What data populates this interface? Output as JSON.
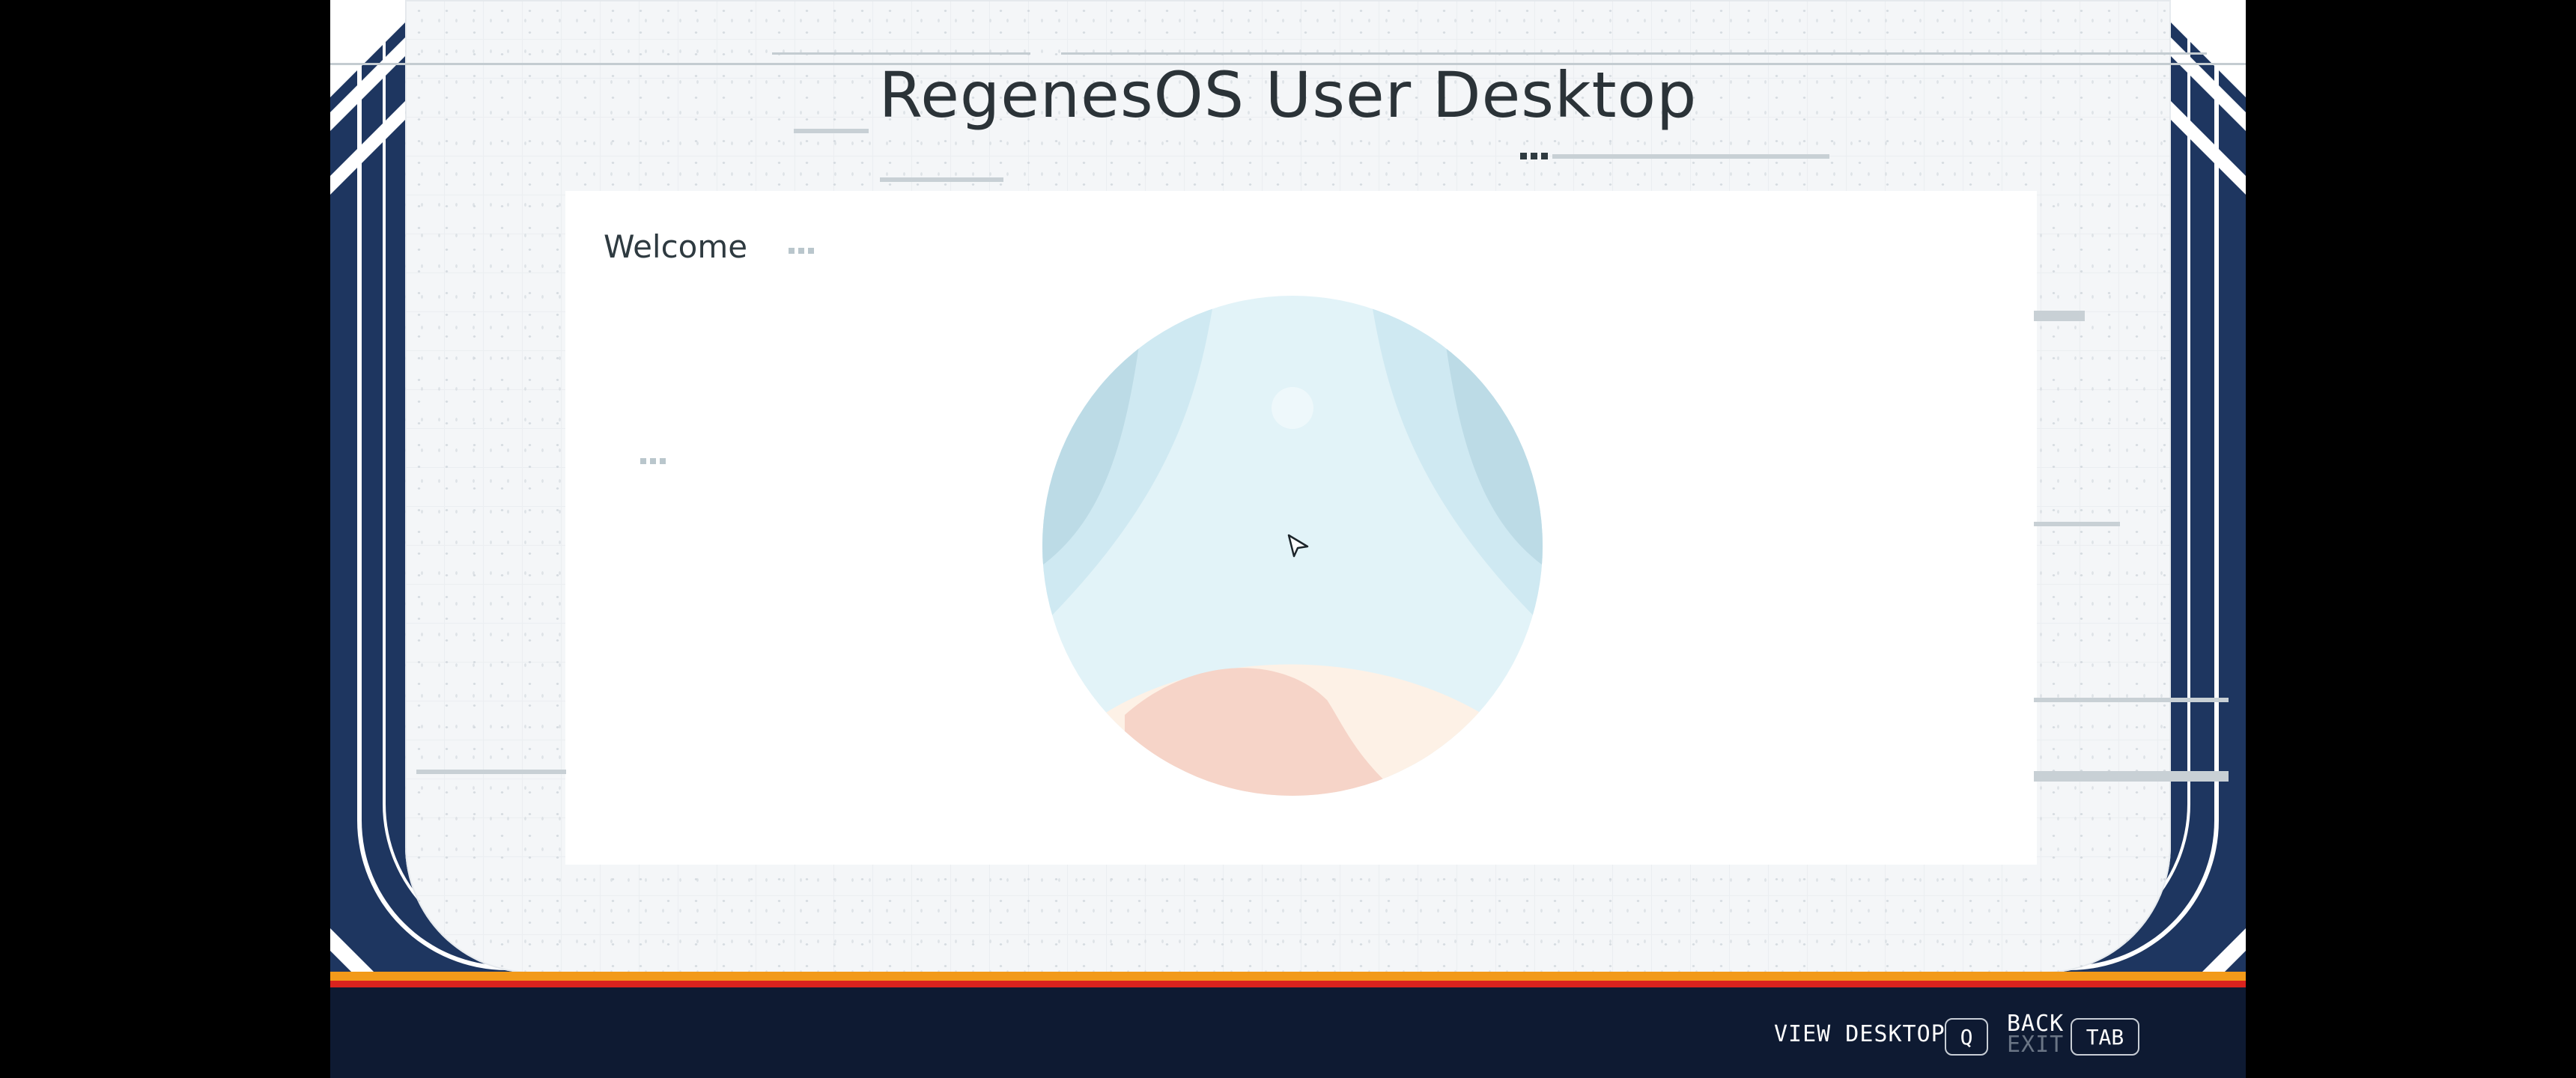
{
  "screen": {
    "title": "RegenesOS User Desktop",
    "welcome_label": "Welcome"
  },
  "footer": {
    "view_desktop_label": "VIEW DESKTOP",
    "view_desktop_key": "Q",
    "back_label": "BACK",
    "exit_label": "EXIT",
    "back_key": "TAB"
  },
  "colors": {
    "frame_navy": "#1e3660",
    "screen_bg": "#f4f6f8",
    "title_text": "#2b3338",
    "stripe_orange": "#f29a1a",
    "stripe_red": "#d9231e",
    "bottom_bar": "#0e1a32"
  },
  "icons": {
    "emblem": "regenesos-logo-icon",
    "pointer": "mouse-cursor-icon"
  }
}
